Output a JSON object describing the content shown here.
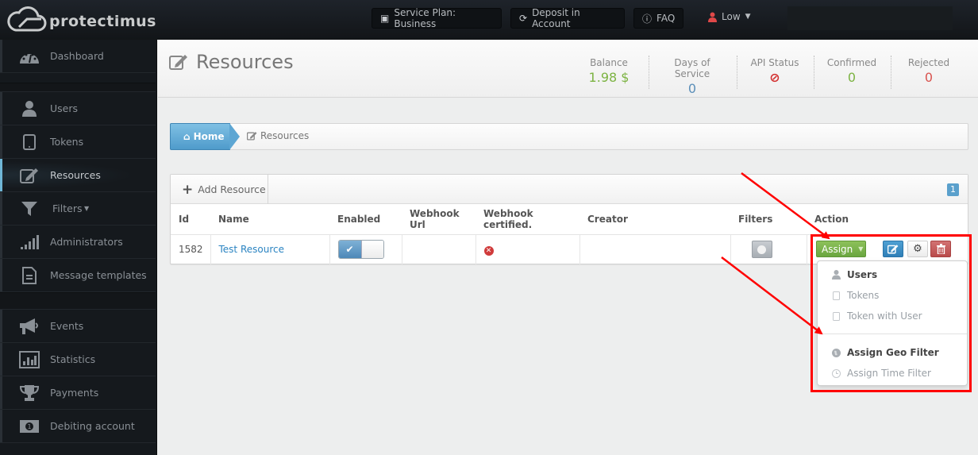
{
  "app": {
    "brand": "protectimus"
  },
  "topbar": {
    "service_plan": "Service Plan: Business",
    "deposit": "Deposit in Account",
    "faq": "FAQ",
    "user": "Low"
  },
  "sidebar": {
    "items": [
      {
        "label": "Dashboard",
        "icon": "dashboard-icon"
      },
      {
        "label": "Users",
        "icon": "user-icon"
      },
      {
        "label": "Tokens",
        "icon": "tablet-icon"
      },
      {
        "label": "Resources",
        "icon": "edit-icon",
        "active": true
      },
      {
        "label": "Filters",
        "icon": "filter-icon",
        "has_caret": true
      },
      {
        "label": "Administrators",
        "icon": "signal-icon"
      },
      {
        "label": "Message templates",
        "icon": "file-icon"
      },
      {
        "label": "Events",
        "icon": "bullhorn-icon"
      },
      {
        "label": "Statistics",
        "icon": "bar-chart-icon"
      },
      {
        "label": "Payments",
        "icon": "trophy-icon"
      },
      {
        "label": "Debiting account",
        "icon": "money-icon"
      }
    ]
  },
  "header": {
    "title": "Resources",
    "stats": [
      {
        "label": "Balance",
        "value": "1.98 $",
        "color": "#7cb342"
      },
      {
        "label": "Days of Service",
        "value": "0",
        "color": "#5b8fb9"
      },
      {
        "label": "API Status",
        "value": "⊘",
        "color": "#d32f2f"
      },
      {
        "label": "Confirmed",
        "value": "0",
        "color": "#7cb342"
      },
      {
        "label": "Rejected",
        "value": "0",
        "color": "#d9534f"
      }
    ]
  },
  "breadcrumb": {
    "home": "Home",
    "current": "Resources"
  },
  "panel": {
    "add_label": "Add Resource",
    "count": "1",
    "columns": [
      "Id",
      "Name",
      "Enabled",
      "Webhook Url",
      "Webhook certified.",
      "Creator",
      "Filters",
      "Action"
    ],
    "rows": [
      {
        "id": "1582",
        "name": "Test Resource",
        "enabled": true,
        "webhook_url": "",
        "webhook_certified": false,
        "creator": ""
      }
    ]
  },
  "actions": {
    "assign_label": "Assign",
    "dropdown": [
      {
        "label": "Users",
        "icon": "user-icon",
        "enabled": true
      },
      {
        "label": "Tokens",
        "icon": "tablet-icon",
        "enabled": false
      },
      {
        "label": "Token with User",
        "icon": "tablet-icon",
        "enabled": false
      },
      {
        "label": "Assign Geo Filter",
        "icon": "globe-icon",
        "enabled": true
      },
      {
        "label": "Assign Time Filter",
        "icon": "clock-icon",
        "enabled": false
      }
    ]
  }
}
